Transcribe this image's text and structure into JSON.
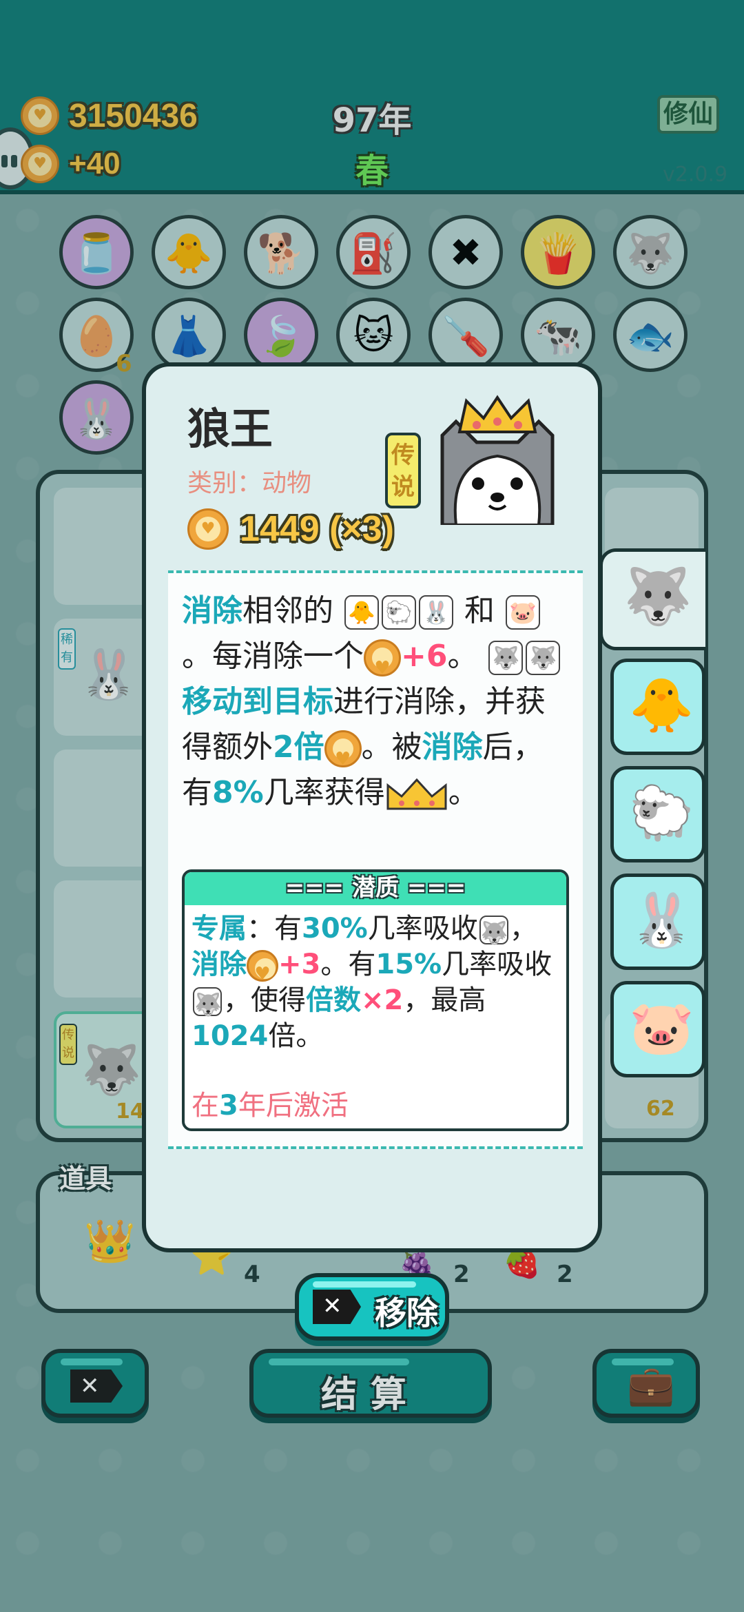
{
  "header": {
    "coins": "3150436",
    "coins_per_turn": "+40",
    "year": "97年",
    "season": "春",
    "xiuxian_label": "修仙",
    "version": "v2.0.9"
  },
  "board": {
    "left_item_tag": "稀有",
    "legend_tag_small": "传说",
    "wolf_count": "14",
    "right_count": "62",
    "egg_count": "6"
  },
  "tools": {
    "label": "道具",
    "counts": [
      "4",
      "2",
      "2"
    ]
  },
  "buttons": {
    "settle": "结算",
    "remove": "移除"
  },
  "card": {
    "name": "狼王",
    "category": "类别：动物",
    "rarity": "传说",
    "value": "1449 (×3)",
    "desc": {
      "w1": "消除",
      "w2": "相邻的",
      "w3": "和",
      "w4": "。每消除一个",
      "w5": "+6",
      "w6": "。",
      "w7": "移动到目标",
      "w8": "进行消除，并获得额外",
      "w9": "2倍",
      "w10": "。被",
      "w11": "消除",
      "w12": "后，有",
      "w13": "8%",
      "w14": "几率获得",
      "w15": "。"
    },
    "potential": {
      "header": "=== 潜质 ===",
      "p1": "专属",
      "p2": "：有",
      "p3": "30%",
      "p4": "几率吸收",
      "p5": "，",
      "p6": "消除",
      "p7": "+3",
      "p8": "。有",
      "p9": "15%",
      "p10": "几率吸收",
      "p11": "，使得",
      "p12": "倍数",
      "p13": "×2",
      "p14": "，最高",
      "p15": "1024",
      "p16": "倍。",
      "activate_pre": "在",
      "activate_num": "3",
      "activate_post": "年后激活"
    }
  },
  "colors": {
    "header_bg": "#117d78",
    "accent_teal": "#1ba8b8",
    "accent_pink": "#ff4f7a",
    "gold": "#f7c646"
  }
}
